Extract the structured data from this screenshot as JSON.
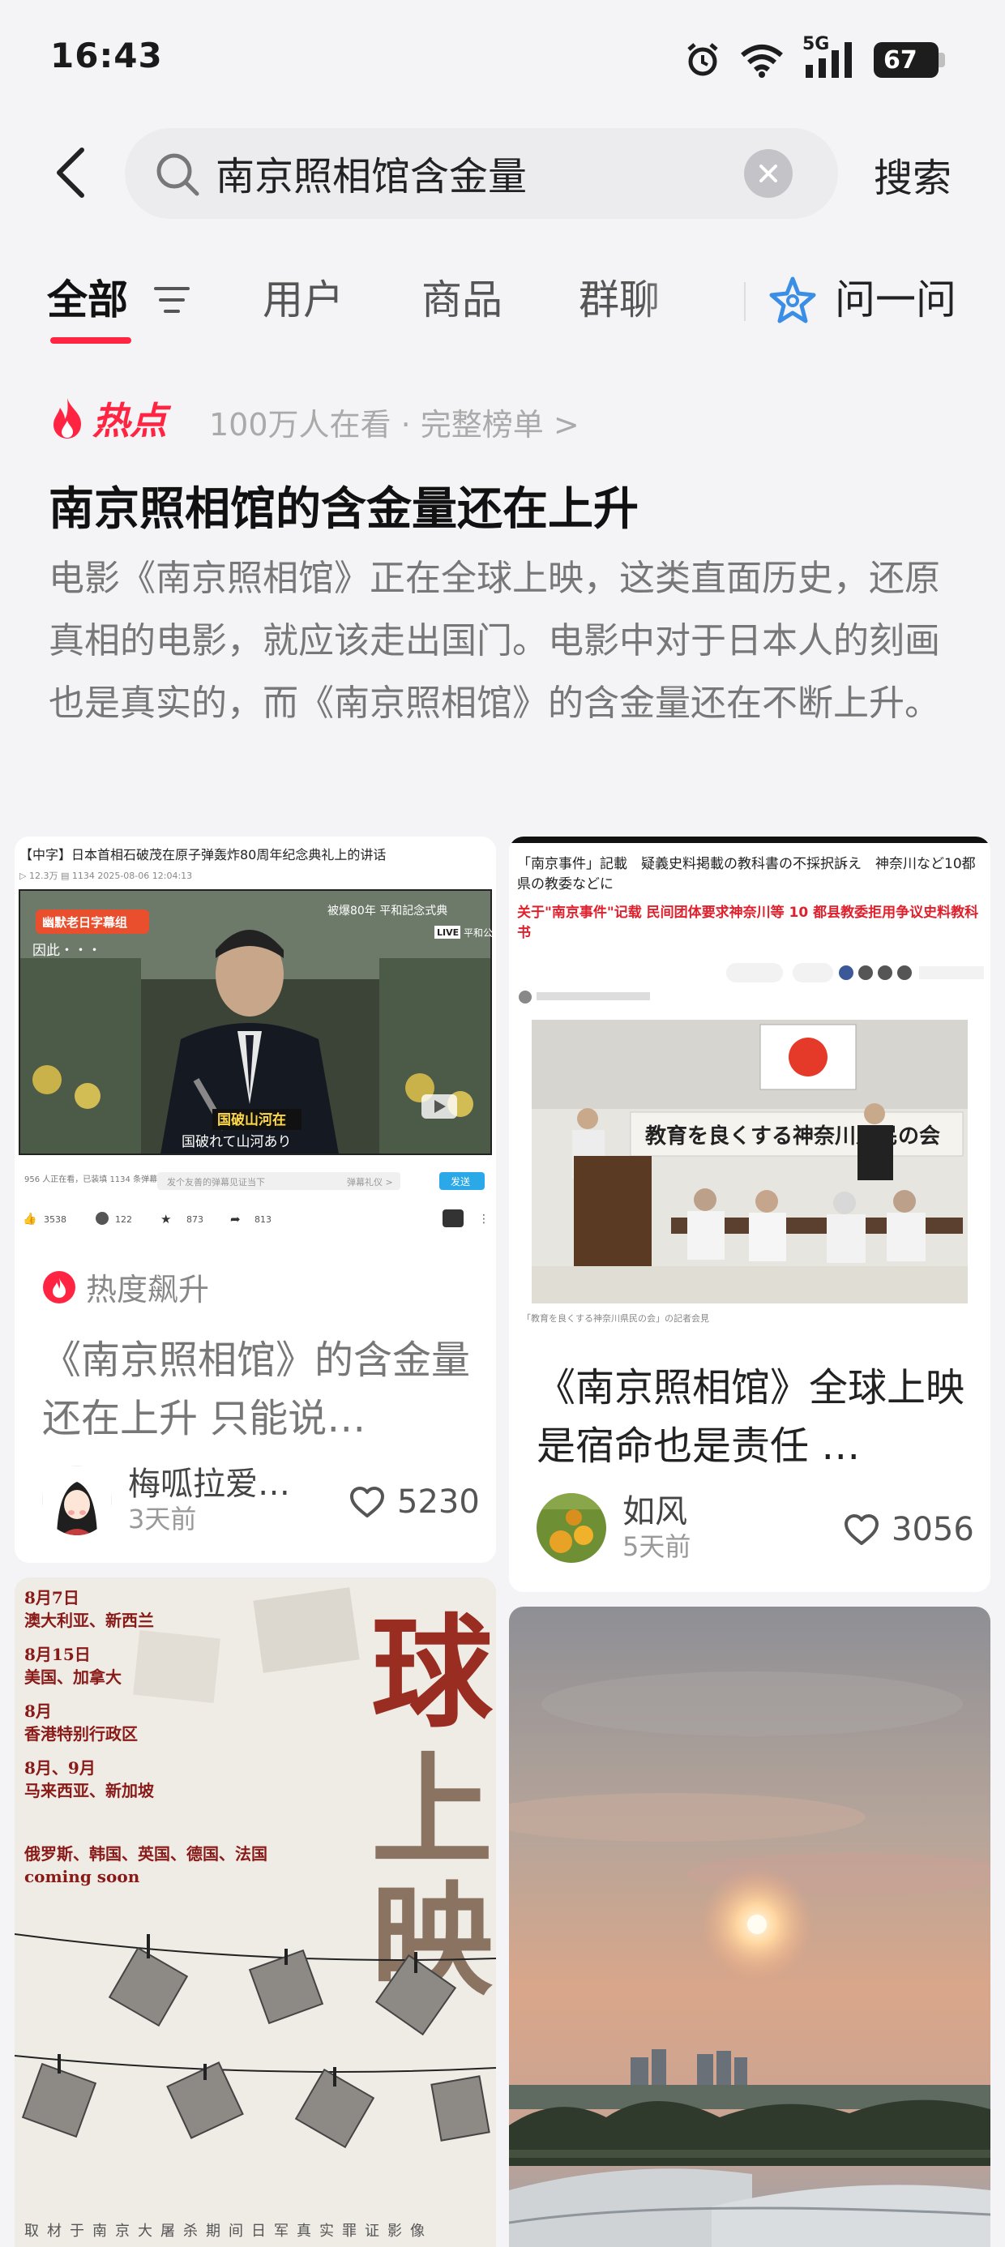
{
  "status": {
    "time": "16:43",
    "network": "5G",
    "battery": "67"
  },
  "search": {
    "query": "南京照相馆含金量",
    "button": "搜索"
  },
  "tabs": {
    "all": "全部",
    "users": "用户",
    "goods": "商品",
    "groups": "群聊",
    "ask": "问一问"
  },
  "hot": {
    "badge": "热点",
    "meta": "100万人在看 · 完整榜单 >",
    "title": "南京照相馆的含金量还在上升",
    "description": "电影《南京照相馆》正在全球上映，这类直面历史，还原真相的电影，就应该走出国门。电影中对于日本人的刻画也是真实的，而《南京照相馆》的含金量还在不断上升。"
  },
  "colors": {
    "accent": "#ff2442",
    "background": "#f4f4f6"
  },
  "cards": [
    {
      "image": {
        "header": "【中字】日本首相石破茂在原子弹轰炸80周年纪念典礼上的讲话",
        "stats": "▷ 12.3万   ▤ 1134   2025-08-06 12:04:13",
        "channel": "幽默老日字幕组",
        "overlay_left": "因此・・・",
        "overlay_top": "被爆80年 平和記念式典",
        "live": "LIVE",
        "live_place": "平和公園",
        "sub_cn": "国破山河在",
        "sub_jp": "国破れて山河あり",
        "danmaku_count": "956 人正在看，已装填 1134 条弹幕",
        "danmaku_hint": "发个友善的弹幕见证当下",
        "danmaku_btn1": "弹幕礼仪 >",
        "danmaku_send": "发送",
        "counts": [
          "3538",
          "122",
          "873",
          "813"
        ]
      },
      "tag": "热度飙升",
      "title": "《南京照相馆》的含金量还在上升 只能说…",
      "author": "梅呱拉爱…",
      "time": "3天前",
      "likes": "5230"
    },
    {
      "image": {
        "headline_jp": "「南京事件」記載　疑義史料掲載の教科書の不採択訴え　神奈川など10都県の教委などに",
        "headline_cn": "关于\"南京事件\"记载 民间团体要求神奈川等 10 都县教委拒用争议史料教科书",
        "banner": "教育を良くする神奈川県民の会",
        "caption": "「教育を良くする神奈川県民の会」の記者会見"
      },
      "title": "《南京照相馆》全球上映是宿命也是责任 …",
      "author": "如风",
      "time": "5天前",
      "likes": "3056"
    },
    {
      "image": {
        "schedule": [
          {
            "date": "8月7日",
            "place": "澳大利亚、新西兰"
          },
          {
            "date": "8月15日",
            "place": "美国、加拿大"
          },
          {
            "date": "8月",
            "place": "香港特别行政区"
          },
          {
            "date": "8月、9月",
            "place": "马来西亚、新加坡"
          },
          {
            "date": "俄罗斯、韩国、英国、德国、法国",
            "place": "coming soon"
          }
        ],
        "big_text": "球上映",
        "footer": "取材于南京大屠杀期间日军真实罪证影像"
      }
    },
    {
      "image": {
        "scene": "sunset"
      }
    }
  ]
}
